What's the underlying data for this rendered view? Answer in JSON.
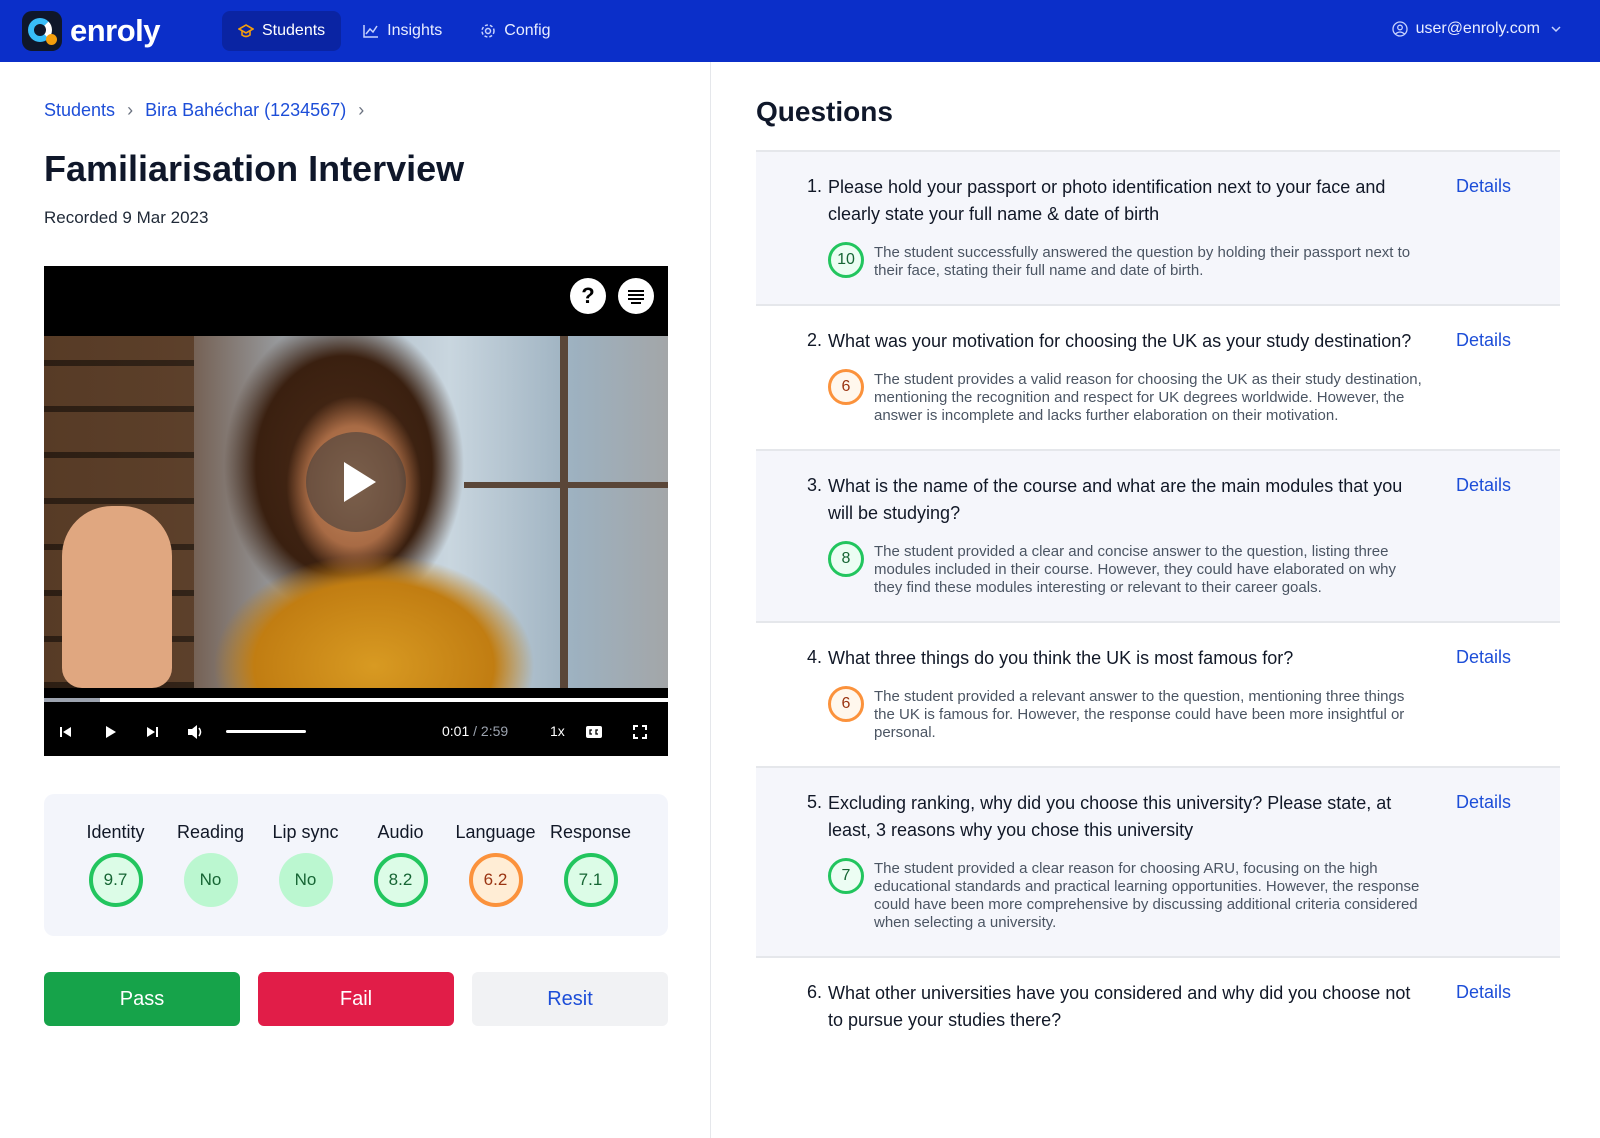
{
  "header": {
    "brand": "enroly",
    "nav": [
      {
        "label": "Students",
        "icon": "graduation-icon",
        "active": true
      },
      {
        "label": "Insights",
        "icon": "chart-icon",
        "active": false
      },
      {
        "label": "Config",
        "icon": "gear-icon",
        "active": false
      }
    ],
    "user_email": "user@enroly.com"
  },
  "breadcrumb": [
    "Students",
    "Bira Bahéchar (1234567)"
  ],
  "page": {
    "title": "Familiarisation Interview",
    "recorded": "Recorded 9 Mar 2023"
  },
  "video": {
    "help_icon": "?",
    "current_time": "0:01",
    "time_separator": "/",
    "duration": "2:59",
    "speed": "1x",
    "played_fraction": 0.09
  },
  "scores": [
    {
      "label": "Identity",
      "value": "9.7",
      "status": "green"
    },
    {
      "label": "Reading",
      "value": "No",
      "status": "green-soft"
    },
    {
      "label": "Lip sync",
      "value": "No",
      "status": "green-soft"
    },
    {
      "label": "Audio",
      "value": "8.2",
      "status": "green"
    },
    {
      "label": "Language",
      "value": "6.2",
      "status": "orange"
    },
    {
      "label": "Response",
      "value": "7.1",
      "status": "green"
    }
  ],
  "actions": {
    "pass": "Pass",
    "fail": "Fail",
    "resit": "Resit"
  },
  "questions_panel": {
    "title": "Questions",
    "details_label": "Details",
    "items": [
      {
        "num": "1.",
        "text": "Please hold your passport or photo identification next to your face and clearly state your full name & date of birth",
        "score": "10",
        "status": "green",
        "summary": "The student successfully answered the question by holding their passport next to their face, stating their full name and date of birth."
      },
      {
        "num": "2.",
        "text": "What was your motivation for choosing the UK as your study destination?",
        "score": "6",
        "status": "orange",
        "summary": "The student provides a valid reason for choosing the UK as their study destination, mentioning the recognition and respect for UK degrees worldwide. However, the answer is incomplete and lacks further elaboration on their motivation."
      },
      {
        "num": "3.",
        "text": "What is the name of the course and what are the main modules that you will be studying?",
        "score": "8",
        "status": "green",
        "summary": "The student provided a clear and concise answer to the question, listing three modules included in their course. However, they could have elaborated on why they find these modules interesting or relevant to their career goals."
      },
      {
        "num": "4.",
        "text": "What three things do you think the UK is most famous for?",
        "score": "6",
        "status": "orange",
        "summary": "The student provided a relevant answer to the question, mentioning three things the UK is famous for. However, the response could have been more insightful or personal."
      },
      {
        "num": "5.",
        "text": "Excluding ranking, why did you choose this university? Please state, at least, 3 reasons why you chose this university",
        "score": "7",
        "status": "green",
        "summary": "The student provided a clear reason for choosing ARU, focusing on the high educational standards and practical learning opportunities. However, the response could have been more comprehensive by discussing additional criteria considered when selecting a university."
      },
      {
        "num": "6.",
        "text": "What other universities have you considered and why did you choose not to pursue your studies there?",
        "score": "",
        "status": "",
        "summary": ""
      }
    ]
  }
}
